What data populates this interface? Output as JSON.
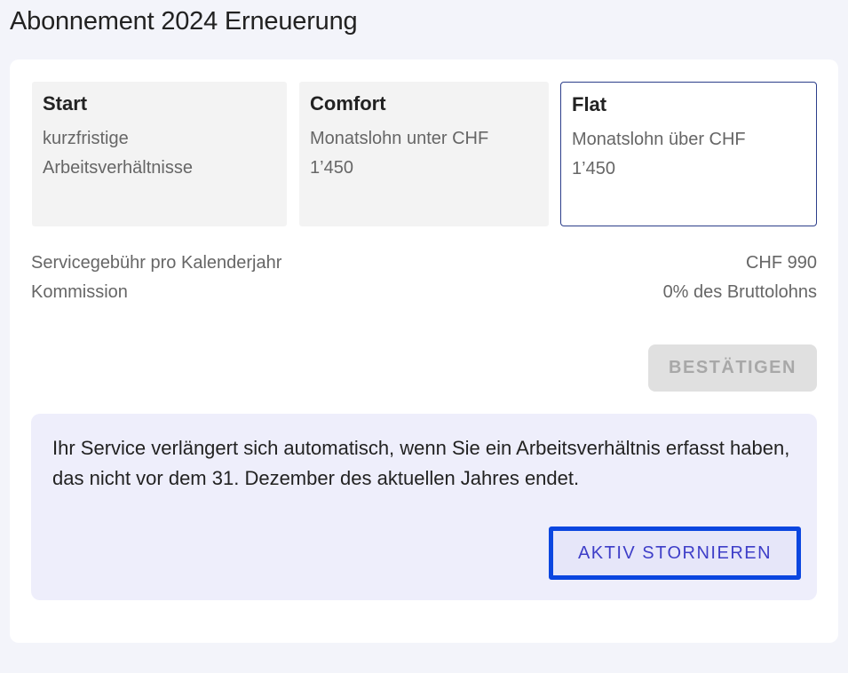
{
  "page": {
    "title": "Abonnement 2024 Erneuerung"
  },
  "plans": [
    {
      "name": "Start",
      "description": "kurzfristige Arbeitsverhältnisse",
      "selected": false
    },
    {
      "name": "Comfort",
      "description": "Monatslohn unter CHF 1’450",
      "selected": false
    },
    {
      "name": "Flat",
      "description": "Monatslohn über CHF 1’450",
      "selected": true
    }
  ],
  "details": {
    "service_fee_label": "Servicegebühr pro Kalenderjahr",
    "service_fee_value": "CHF 990",
    "commission_label": "Kommission",
    "commission_value": "0% des Bruttolohns"
  },
  "actions": {
    "confirm_label": "BESTÄTIGEN",
    "confirm_disabled": true
  },
  "notice": {
    "text": "Ihr Service verlängert sich automatisch, wenn Sie ein Arbeitsverhältnis erfasst haben, das nicht vor dem 31. Dezember des aktuellen Jahres endet.",
    "cancel_label": "AKTIV STORNIEREN"
  },
  "colors": {
    "page_background": "#f3f4fa",
    "selected_border": "#2c3e8a",
    "notice_background": "#eeeefb",
    "cancel_button_border": "#0b46e0",
    "cancel_button_text": "#3e3ec8"
  }
}
